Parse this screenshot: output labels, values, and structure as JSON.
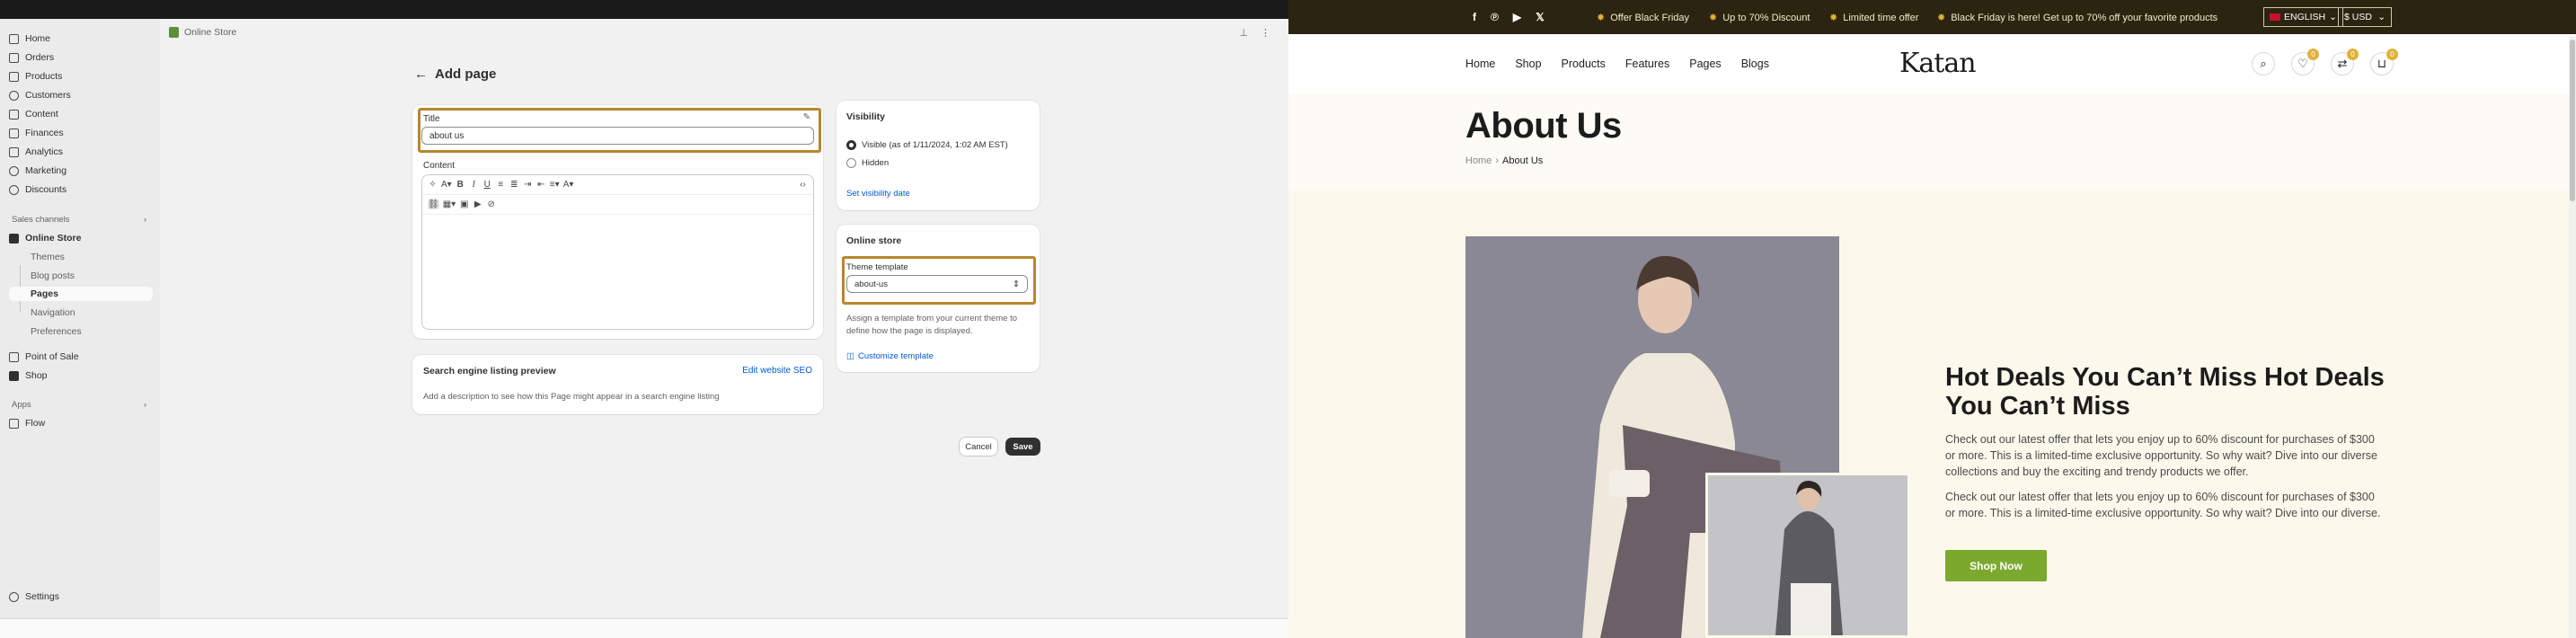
{
  "admin": {
    "header_title": "Online Store",
    "sidebar": {
      "items": [
        {
          "label": "Home"
        },
        {
          "label": "Orders"
        },
        {
          "label": "Products"
        },
        {
          "label": "Customers"
        },
        {
          "label": "Content"
        },
        {
          "label": "Finances"
        },
        {
          "label": "Analytics"
        },
        {
          "label": "Marketing"
        },
        {
          "label": "Discounts"
        }
      ],
      "sales_channels_title": "Sales channels",
      "online_store": "Online Store",
      "sub_items": [
        {
          "label": "Themes"
        },
        {
          "label": "Blog posts"
        },
        {
          "label": "Pages"
        },
        {
          "label": "Navigation"
        },
        {
          "label": "Preferences"
        }
      ],
      "pos": "Point of Sale",
      "shop": "Shop",
      "apps_title": "Apps",
      "flow": "Flow",
      "settings": "Settings"
    },
    "page_title": "Add page",
    "title_label": "Title",
    "title_value": "about us",
    "content_label": "Content",
    "seo": {
      "title": "Search engine listing preview",
      "edit_link": "Edit website SEO",
      "desc": "Add a description to see how this Page might appear in a search engine listing"
    },
    "visibility": {
      "title": "Visibility",
      "visible_label": "Visible (as of 1/11/2024, 1:02 AM EST)",
      "hidden_label": "Hidden",
      "set_date_link": "Set visibility date"
    },
    "online_store_card": {
      "title": "Online store",
      "template_label": "Theme template",
      "template_value": "about-us",
      "help": "Assign a template from your current theme to define how the page is displayed.",
      "customize_link": "Customize template"
    },
    "cancel_label": "Cancel",
    "save_label": "Save"
  },
  "store": {
    "announcements": [
      {
        "text": "Offer Black Friday"
      },
      {
        "text": "Up to 70% Discount"
      },
      {
        "text": "Limited time offer"
      },
      {
        "text": "Black Friday is here! Get up to 70% off your favorite products"
      }
    ],
    "language": "ENGLISH",
    "currency": "$ USD",
    "menu": [
      {
        "label": "Home"
      },
      {
        "label": "Shop"
      },
      {
        "label": "Products"
      },
      {
        "label": "Features"
      },
      {
        "label": "Pages"
      },
      {
        "label": "Blogs"
      }
    ],
    "logo": "Katan",
    "wishlist_count": "0",
    "compare_count": "0",
    "cart_count": "0",
    "page_heading": "About Us",
    "breadcrumb_home": "Home",
    "breadcrumb_current": "About Us",
    "hero_title": "Hot Deals You Can’t Miss Hot Deals You Can’t Miss",
    "para1": "Check out our latest offer that lets you enjoy up to 60% discount for purchases of $300 or more. This is a limited-time exclusive opportunity. So why wait? Dive into our diverse collections and buy the exciting and trendy products we offer.",
    "para2": "Check out our latest offer that lets you enjoy up to 60% discount for purchases of $300 or more. This is a limited-time exclusive opportunity. So why wait? Dive into our diverse.",
    "shop_now": "Shop Now"
  }
}
